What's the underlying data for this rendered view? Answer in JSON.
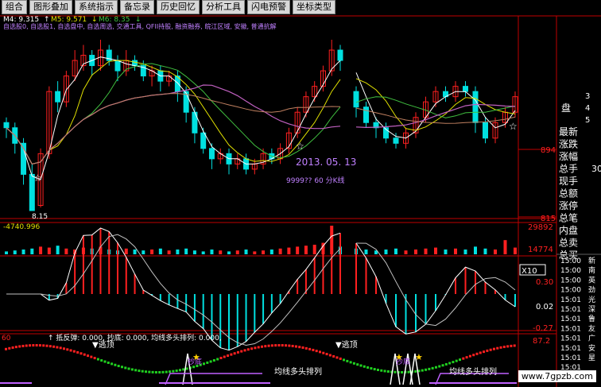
{
  "toolbar": {
    "items": [
      "组合",
      "图形叠加",
      "系统指示",
      "备忘录",
      "历史回忆",
      "分析工具",
      "闪电预警",
      "坐标类型"
    ]
  },
  "ma_legend": {
    "m4": "M4: 9.315",
    "m5": "M5: 9.571",
    "m6": "M6: 8.35",
    "arrows": [
      "↑",
      "↓",
      "↓"
    ]
  },
  "blocks_line": "自选股0, 自选股1, 自选盘中, 自选周选, 交通工具, QFII持股, 融资融券, 皖江区域, 安徽, 普通抗解",
  "annotations": {
    "date": "2013. 05. 13",
    "low_price": "8.15",
    "vol_label": "-4740.996",
    "peak_tag_partial": "9999?? 60 分K线"
  },
  "indicator_line": {
    "prefix": "60",
    "text": "↑ 抵反弹: 0.000, 抄底: 0.000, 均线多头排列: 0.000,"
  },
  "bottom_labels": {
    "escape1": "逃顶",
    "escape2": "逃顶",
    "chaodi1": "抄底",
    "chaodi2": "抄底",
    "bull1": "均线多头排列",
    "bull2": "均线多头排列"
  },
  "price_axis": {
    "p894": "894",
    "p815": "815"
  },
  "volume_axis": {
    "top": "29892",
    "mid": "14774",
    "unit": "X10"
  },
  "macd_axis": {
    "top": "0.30",
    "mid": "0.02",
    "bottom": "-0.27"
  },
  "kdj_axis": {
    "top": "87.2"
  },
  "right_panel": {
    "labels": [
      "最新",
      "涨跌",
      "涨幅",
      "总手",
      "现手",
      "总额",
      "涨停",
      "总笔",
      "内盘",
      "总卖",
      "总买"
    ],
    "small_nums": [
      "3",
      "4",
      "5"
    ],
    "pan": "盘",
    "big_val": "30",
    "times": [
      "15:00",
      "15:00",
      "15:00",
      "15:00",
      "15:01",
      "15:01",
      "15:01",
      "15:01",
      "15:01",
      "15:01",
      "15:01",
      "15:01",
      "15:01"
    ],
    "names": [
      "新",
      "南",
      "英",
      "劲",
      "光",
      "深",
      "鲁",
      "友",
      "广",
      "安",
      "星"
    ]
  },
  "watermark": "www.7gpzb.com",
  "colors": {
    "up": "#ff2020",
    "down": "#00e0e0",
    "ma_white": "#ffffff",
    "ma_yellow": "#e0e000",
    "ma_green": "#40c040",
    "ma_purple": "#c060c0",
    "ma_brown": "#c08060",
    "axis_red": "#c00000",
    "legend_purple": "#c080ff"
  },
  "chart_data": {
    "type": "candlestick",
    "title": "",
    "price_range": [
      8.15,
      9.8
    ],
    "candles": [
      [
        9.0,
        8.95,
        9.05,
        8.85
      ],
      [
        8.95,
        8.8,
        9.0,
        8.7
      ],
      [
        8.8,
        8.5,
        8.85,
        8.4
      ],
      [
        8.5,
        8.15,
        8.6,
        8.15
      ],
      [
        8.2,
        8.7,
        8.75,
        8.18
      ],
      [
        8.7,
        9.3,
        9.35,
        8.65
      ],
      [
        9.3,
        9.2,
        9.4,
        9.1
      ],
      [
        9.2,
        9.45,
        9.5,
        9.15
      ],
      [
        9.45,
        9.6,
        9.7,
        9.4
      ],
      [
        9.55,
        9.65,
        9.75,
        9.5
      ],
      [
        9.65,
        9.55,
        9.7,
        9.45
      ],
      [
        9.55,
        9.7,
        9.8,
        9.5
      ],
      [
        9.7,
        9.6,
        9.75,
        9.55
      ],
      [
        9.6,
        9.5,
        9.65,
        9.4
      ],
      [
        9.5,
        9.6,
        9.7,
        9.45
      ],
      [
        9.6,
        9.55,
        9.65,
        9.5
      ],
      [
        9.55,
        9.45,
        9.6,
        9.4
      ],
      [
        9.45,
        9.5,
        9.55,
        9.35
      ],
      [
        9.5,
        9.4,
        9.55,
        9.3
      ],
      [
        9.4,
        9.45,
        9.5,
        9.35
      ],
      [
        9.45,
        9.3,
        9.5,
        9.2
      ],
      [
        9.3,
        9.1,
        9.35,
        9.0
      ],
      [
        9.1,
        8.9,
        9.15,
        8.8
      ],
      [
        8.9,
        8.75,
        8.95,
        8.7
      ],
      [
        8.75,
        8.65,
        8.8,
        8.55
      ],
      [
        8.65,
        8.7,
        8.75,
        8.6
      ],
      [
        8.7,
        8.6,
        8.75,
        8.5
      ],
      [
        8.6,
        8.65,
        8.7,
        8.55
      ],
      [
        8.65,
        8.55,
        8.7,
        8.5
      ],
      [
        8.55,
        8.6,
        8.65,
        8.5
      ],
      [
        8.6,
        8.7,
        8.75,
        8.55
      ],
      [
        8.7,
        8.65,
        8.75,
        8.6
      ],
      [
        8.65,
        8.75,
        8.8,
        8.6
      ],
      [
        8.75,
        8.9,
        8.95,
        8.7
      ],
      [
        8.9,
        9.1,
        9.15,
        8.85
      ],
      [
        9.1,
        9.25,
        9.3,
        9.05
      ],
      [
        9.25,
        9.35,
        9.4,
        9.2
      ],
      [
        9.35,
        9.5,
        9.55,
        9.3
      ],
      [
        9.5,
        9.7,
        9.8,
        9.45
      ],
      [
        9.7,
        9.6,
        9.75,
        9.5
      ],
      [
        9.3,
        9.15,
        9.35,
        9.05
      ],
      [
        9.15,
        9.0,
        9.2,
        8.95
      ],
      [
        9.0,
        8.95,
        9.05,
        8.85
      ],
      [
        8.95,
        8.85,
        9.0,
        8.8
      ],
      [
        8.85,
        8.8,
        8.9,
        8.75
      ],
      [
        8.8,
        8.9,
        8.95,
        8.75
      ],
      [
        8.9,
        9.05,
        9.1,
        8.85
      ],
      [
        9.05,
        9.2,
        9.25,
        9.0
      ],
      [
        9.2,
        9.3,
        9.35,
        9.15
      ],
      [
        9.3,
        9.25,
        9.35,
        9.2
      ],
      [
        9.25,
        9.35,
        9.4,
        9.2
      ],
      [
        9.35,
        9.3,
        9.4,
        9.25
      ],
      [
        9.3,
        9.0,
        9.35,
        8.9
      ],
      [
        9.0,
        8.85,
        9.05,
        8.8
      ],
      [
        8.85,
        9.0,
        9.05,
        8.8
      ],
      [
        9.0,
        9.1,
        9.15,
        8.95
      ],
      [
        9.1,
        9.25,
        9.3,
        9.05
      ]
    ],
    "volumes": [
      3,
      4,
      5,
      6,
      8,
      7,
      9,
      6,
      5,
      7,
      6,
      8,
      5,
      4,
      6,
      5,
      4,
      5,
      6,
      4,
      5,
      6,
      4,
      3,
      5,
      4,
      3,
      4,
      5,
      3,
      4,
      5,
      6,
      7,
      8,
      9,
      10,
      12,
      29.9,
      8,
      6,
      5,
      4,
      5,
      6,
      4,
      5,
      6,
      7,
      5,
      6,
      5,
      8,
      6,
      5,
      14.8,
      7
    ],
    "volume_unit": "X10"
  }
}
